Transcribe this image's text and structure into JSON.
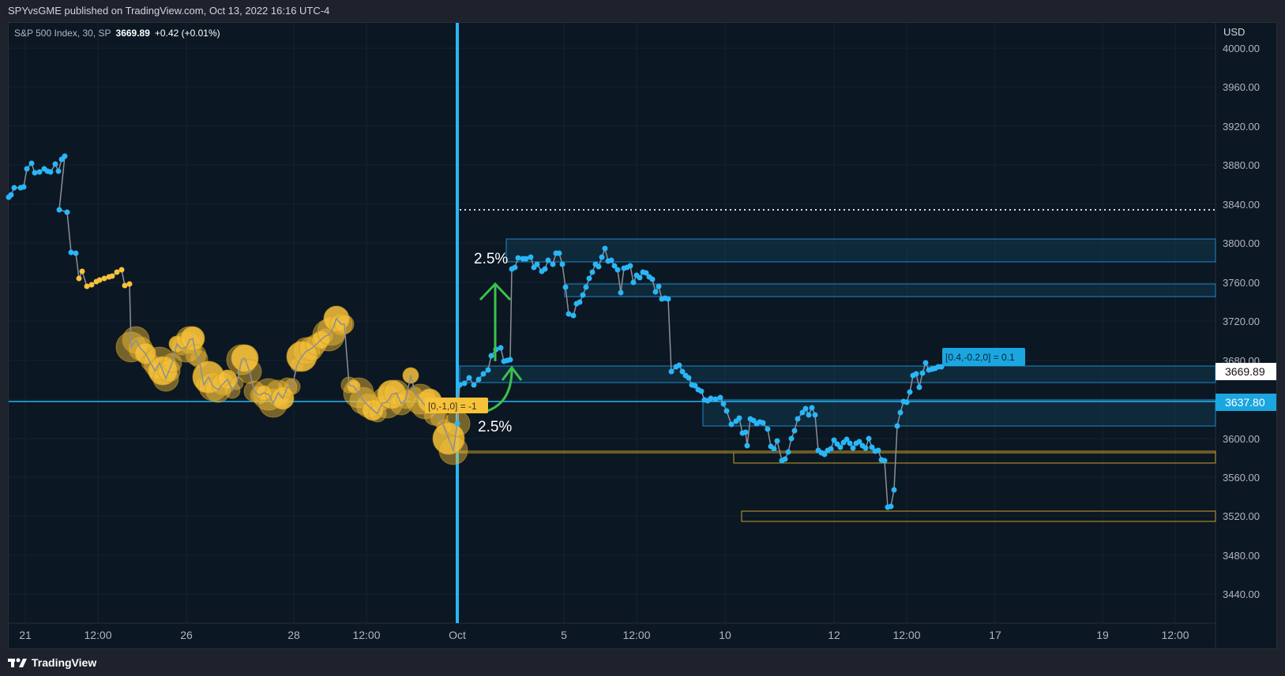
{
  "header": {
    "published": "SPYvsGME published on TradingView.com, Oct 13, 2022 16:16 UTC-4"
  },
  "legend": {
    "symbol": "S&P 500 Index, 30, SP",
    "price": "3669.89",
    "change": "+0.42 (+0.01%)"
  },
  "price_axis": {
    "currency": "USD",
    "ticks": [
      "4000.00",
      "3960.00",
      "3920.00",
      "3880.00",
      "3840.00",
      "3800.00",
      "3760.00",
      "3720.00",
      "3680.00",
      "3640.00",
      "3600.00",
      "3560.00",
      "3520.00",
      "3480.00",
      "3440.00"
    ],
    "current_label": "3669.89",
    "crosshair_label": "3637.80"
  },
  "time_axis": {
    "ticks": [
      "21",
      "12:00",
      "26",
      "28",
      "12:00",
      "Oct",
      "5",
      "12:00",
      "10",
      "12",
      "12:00",
      "17",
      "19",
      "12:00"
    ]
  },
  "annotations": {
    "up_pct_top": "2.5%",
    "up_pct_bottom": "2.5%",
    "left_tag": "[0,-1,0] = -1",
    "right_tag": "[0.4,-0.2,0] = 0.1"
  },
  "footer": {
    "brand": "TradingView"
  },
  "colors": {
    "background": "#0b1723",
    "frame": "#1e222d",
    "blue": "#29b6f6",
    "yellow": "#f7c23a",
    "green": "#3cc14b",
    "zone_fill": "#12384e"
  }
}
